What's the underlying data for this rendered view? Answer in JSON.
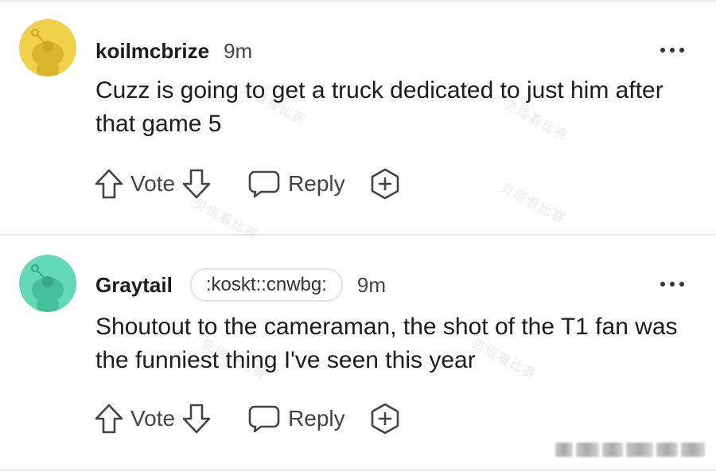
{
  "comments": [
    {
      "username": "koilmcbrize",
      "flair": "",
      "time": "9m",
      "body": "Cuzz is going to get a truck dedicated to just him after that game 5",
      "vote_label": "Vote",
      "reply_label": "Reply",
      "avatar_color": "#f1d04b"
    },
    {
      "username": "Graytail",
      "flair": ":koskt::cnwbg:",
      "time": "9m",
      "body": "Shoutout to the cameraman, the shot of the T1 fan was the funniest thing I've seen this year",
      "vote_label": "Vote",
      "reply_label": "Reply",
      "avatar_color": "#63d9b5"
    }
  ],
  "icons": {
    "upvote": "arrow-up-icon",
    "downvote": "arrow-down-icon",
    "reply": "speech-bubble-icon",
    "award": "award-plus-icon",
    "more": "more-dots-icon"
  },
  "watermark_text": "贝塔看比赛"
}
